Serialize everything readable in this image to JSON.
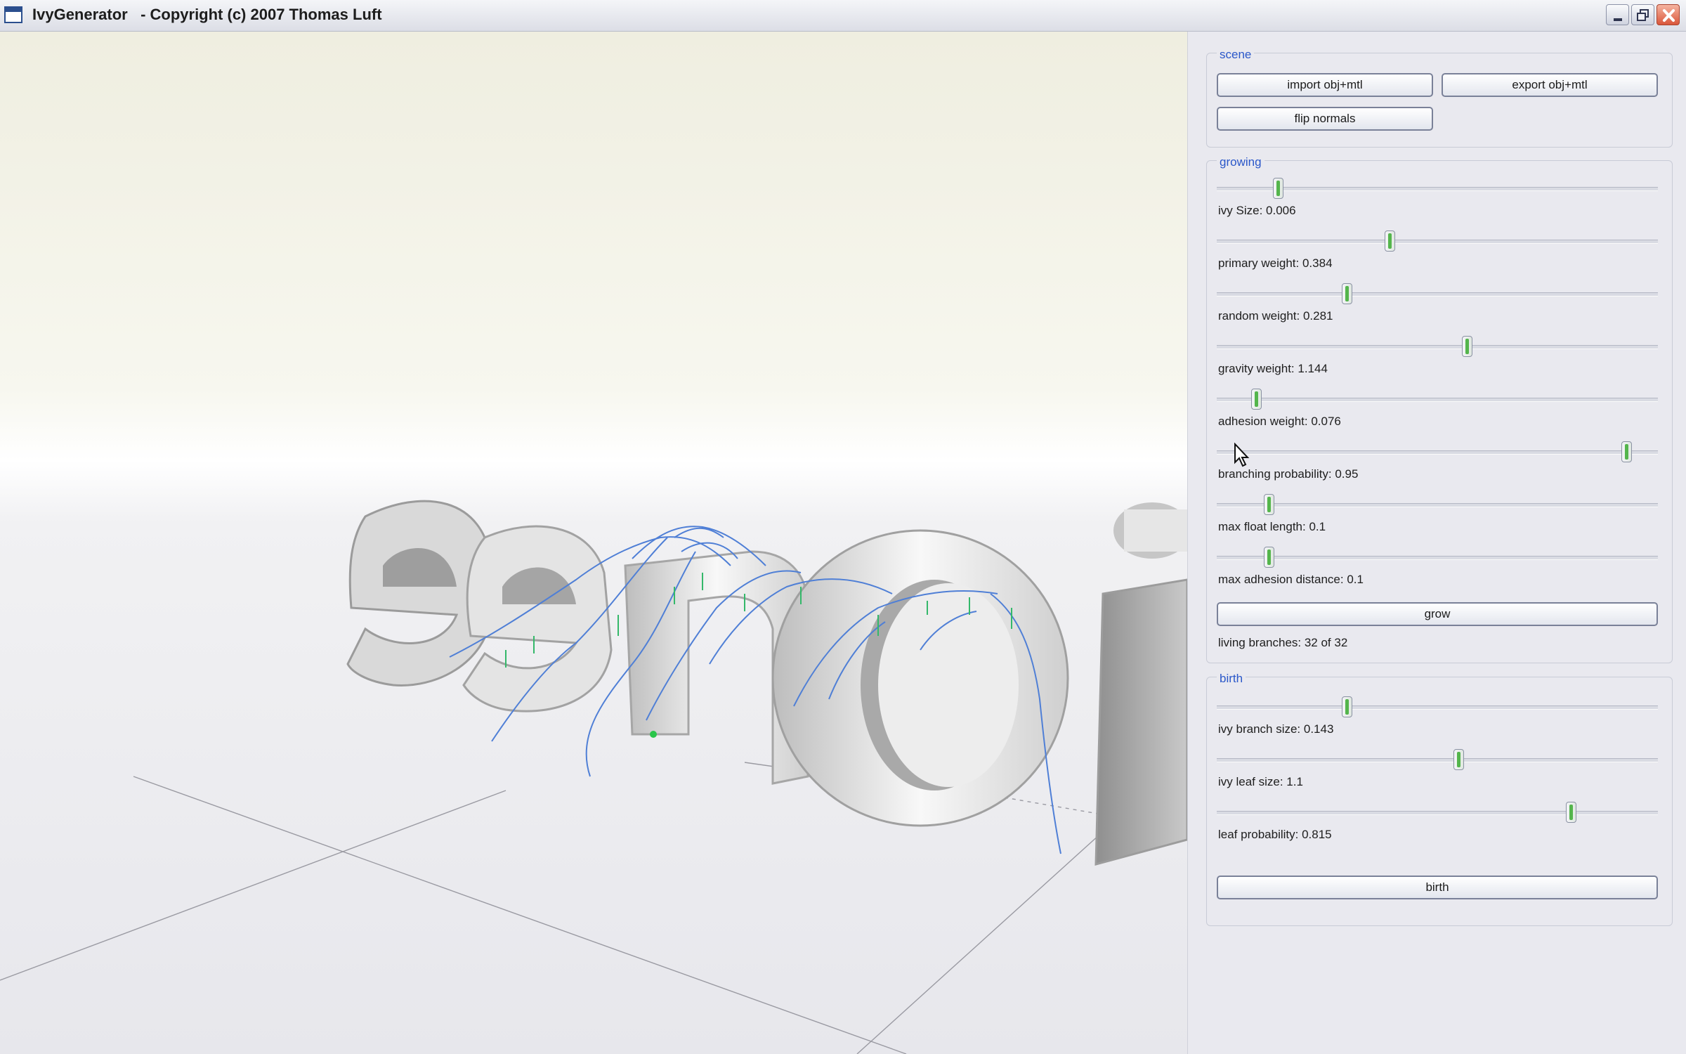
{
  "window": {
    "title": "IvyGenerator   - Copyright (c) 2007 Thomas Luft"
  },
  "icons": {
    "app": "app-window-icon",
    "minimize": "minimize-icon",
    "maximize": "maximize-icon",
    "close": "close-icon",
    "cursor": "mouse-pointer-icon"
  },
  "viewport": {
    "scene_text": "ioneer"
  },
  "scene": {
    "title": "scene",
    "import_label": "import obj+mtl",
    "export_label": "export obj+mtl",
    "flip_label": "flip normals"
  },
  "growing": {
    "title": "growing",
    "sliders": [
      {
        "label": "ivy Size: 0.006",
        "position": 0.13
      },
      {
        "label": "primary weight: 0.384",
        "position": 0.39
      },
      {
        "label": "random weight: 0.281",
        "position": 0.29
      },
      {
        "label": "gravity weight: 1.144",
        "position": 0.57
      },
      {
        "label": "adhesion weight: 0.076",
        "position": 0.08
      },
      {
        "label": "branching probability: 0.95",
        "position": 0.94
      },
      {
        "label": "max float length: 0.1",
        "position": 0.11
      },
      {
        "label": "max adhesion distance: 0.1",
        "position": 0.11
      }
    ],
    "grow_label": "grow",
    "status": "living branches: 32 of 32"
  },
  "birth": {
    "title": "birth",
    "sliders": [
      {
        "label": "ivy branch size: 0.143",
        "position": 0.29
      },
      {
        "label": "ivy leaf size: 1.1",
        "position": 0.55
      },
      {
        "label": "leaf probability: 0.815",
        "position": 0.81
      }
    ],
    "birth_label": "birth"
  }
}
